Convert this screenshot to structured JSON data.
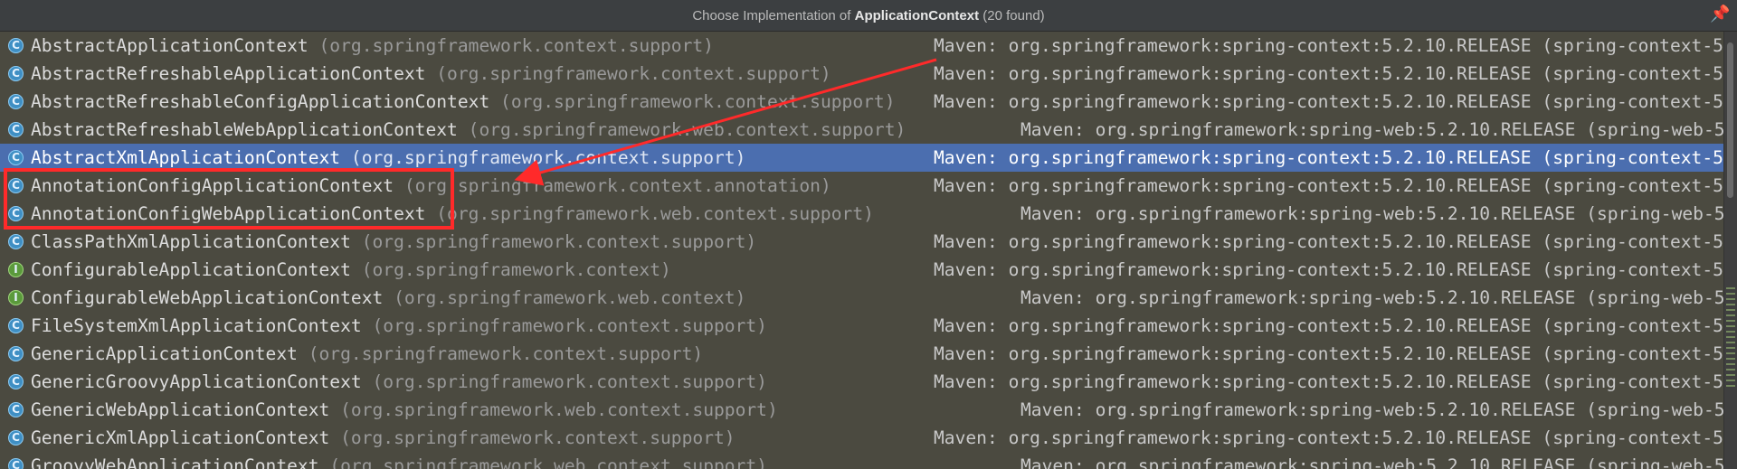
{
  "header": {
    "prefix": "Choose Implementation of ",
    "subject": "ApplicationContext",
    "suffix": " (20 found)"
  },
  "icons": {
    "pin": "pin-icon",
    "class": "class-icon",
    "interface": "interface-icon"
  },
  "colors": {
    "selected_row": "#4b6eaf",
    "annotation": "#ff2a2a"
  },
  "items": [
    {
      "name": "AbstractApplicationContext",
      "package": "(org.springframework.context.support)",
      "location": "Maven: org.springframework:spring-context:5.2.10.RELEASE (spring-context-5",
      "kind": "class",
      "selected": false
    },
    {
      "name": "AbstractRefreshableApplicationContext",
      "package": "(org.springframework.context.support)",
      "location": "Maven: org.springframework:spring-context:5.2.10.RELEASE (spring-context-5",
      "kind": "class",
      "selected": false
    },
    {
      "name": "AbstractRefreshableConfigApplicationContext",
      "package": "(org.springframework.context.support)",
      "location": "Maven: org.springframework:spring-context:5.2.10.RELEASE (spring-context-5",
      "kind": "class",
      "selected": false
    },
    {
      "name": "AbstractRefreshableWebApplicationContext",
      "package": "(org.springframework.web.context.support)",
      "location": "Maven: org.springframework:spring-web:5.2.10.RELEASE (spring-web-5",
      "kind": "class",
      "selected": false
    },
    {
      "name": "AbstractXmlApplicationContext",
      "package": "(org.springframework.context.support)",
      "location": "Maven: org.springframework:spring-context:5.2.10.RELEASE (spring-context-5",
      "kind": "class",
      "selected": true
    },
    {
      "name": "AnnotationConfigApplicationContext",
      "package": "(org.springframework.context.annotation)",
      "location": "Maven: org.springframework:spring-context:5.2.10.RELEASE (spring-context-5",
      "kind": "class",
      "selected": false
    },
    {
      "name": "AnnotationConfigWebApplicationContext",
      "package": "(org.springframework.web.context.support)",
      "location": "Maven: org.springframework:spring-web:5.2.10.RELEASE (spring-web-5",
      "kind": "class",
      "selected": false
    },
    {
      "name": "ClassPathXmlApplicationContext",
      "package": "(org.springframework.context.support)",
      "location": "Maven: org.springframework:spring-context:5.2.10.RELEASE (spring-context-5",
      "kind": "class",
      "selected": false
    },
    {
      "name": "ConfigurableApplicationContext",
      "package": "(org.springframework.context)",
      "location": "Maven: org.springframework:spring-context:5.2.10.RELEASE (spring-context-5",
      "kind": "interface",
      "selected": false
    },
    {
      "name": "ConfigurableWebApplicationContext",
      "package": "(org.springframework.web.context)",
      "location": "Maven: org.springframework:spring-web:5.2.10.RELEASE (spring-web-5",
      "kind": "interface",
      "selected": false
    },
    {
      "name": "FileSystemXmlApplicationContext",
      "package": "(org.springframework.context.support)",
      "location": "Maven: org.springframework:spring-context:5.2.10.RELEASE (spring-context-5",
      "kind": "class",
      "selected": false
    },
    {
      "name": "GenericApplicationContext",
      "package": "(org.springframework.context.support)",
      "location": "Maven: org.springframework:spring-context:5.2.10.RELEASE (spring-context-5",
      "kind": "class",
      "selected": false
    },
    {
      "name": "GenericGroovyApplicationContext",
      "package": "(org.springframework.context.support)",
      "location": "Maven: org.springframework:spring-context:5.2.10.RELEASE (spring-context-5",
      "kind": "class",
      "selected": false
    },
    {
      "name": "GenericWebApplicationContext",
      "package": "(org.springframework.web.context.support)",
      "location": "Maven: org.springframework:spring-web:5.2.10.RELEASE (spring-web-5",
      "kind": "class",
      "selected": false
    },
    {
      "name": "GenericXmlApplicationContext",
      "package": "(org.springframework.context.support)",
      "location": "Maven: org.springframework:spring-context:5.2.10.RELEASE (spring-context-5",
      "kind": "class",
      "selected": false
    },
    {
      "name": "GroovyWebApplicationContext",
      "package": "(org.springframework.web.context.support)",
      "location": "Maven: org.springframework:spring-web:5.2.10.RELEASE (spring-web-5",
      "kind": "class",
      "selected": false
    }
  ]
}
